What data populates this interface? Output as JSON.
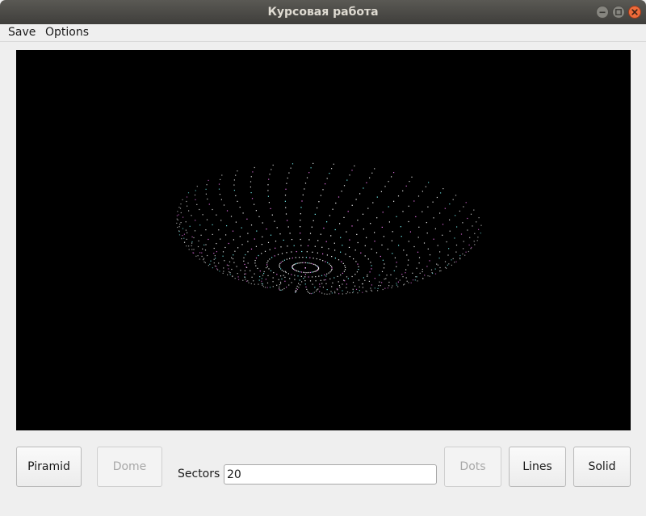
{
  "window": {
    "title": "Курсовая работа"
  },
  "menu": {
    "items": [
      {
        "label": "Save"
      },
      {
        "label": "Options"
      }
    ]
  },
  "viewport": {
    "background": "#000000",
    "render_mode": "dots",
    "dot_colors": [
      "#ffffff",
      "#ff7bff",
      "#7bffff"
    ]
  },
  "controls": {
    "piramid_label": "Piramid",
    "dome_label": "Dome",
    "dome_enabled": false,
    "sectors_label": "Sectors",
    "sectors_value": "20",
    "dots_label": "Dots",
    "dots_enabled": false,
    "lines_label": "Lines",
    "solid_label": "Solid"
  },
  "icons": {
    "minimize": "minimize-icon",
    "maximize": "maximize-icon",
    "close": "close-icon"
  }
}
